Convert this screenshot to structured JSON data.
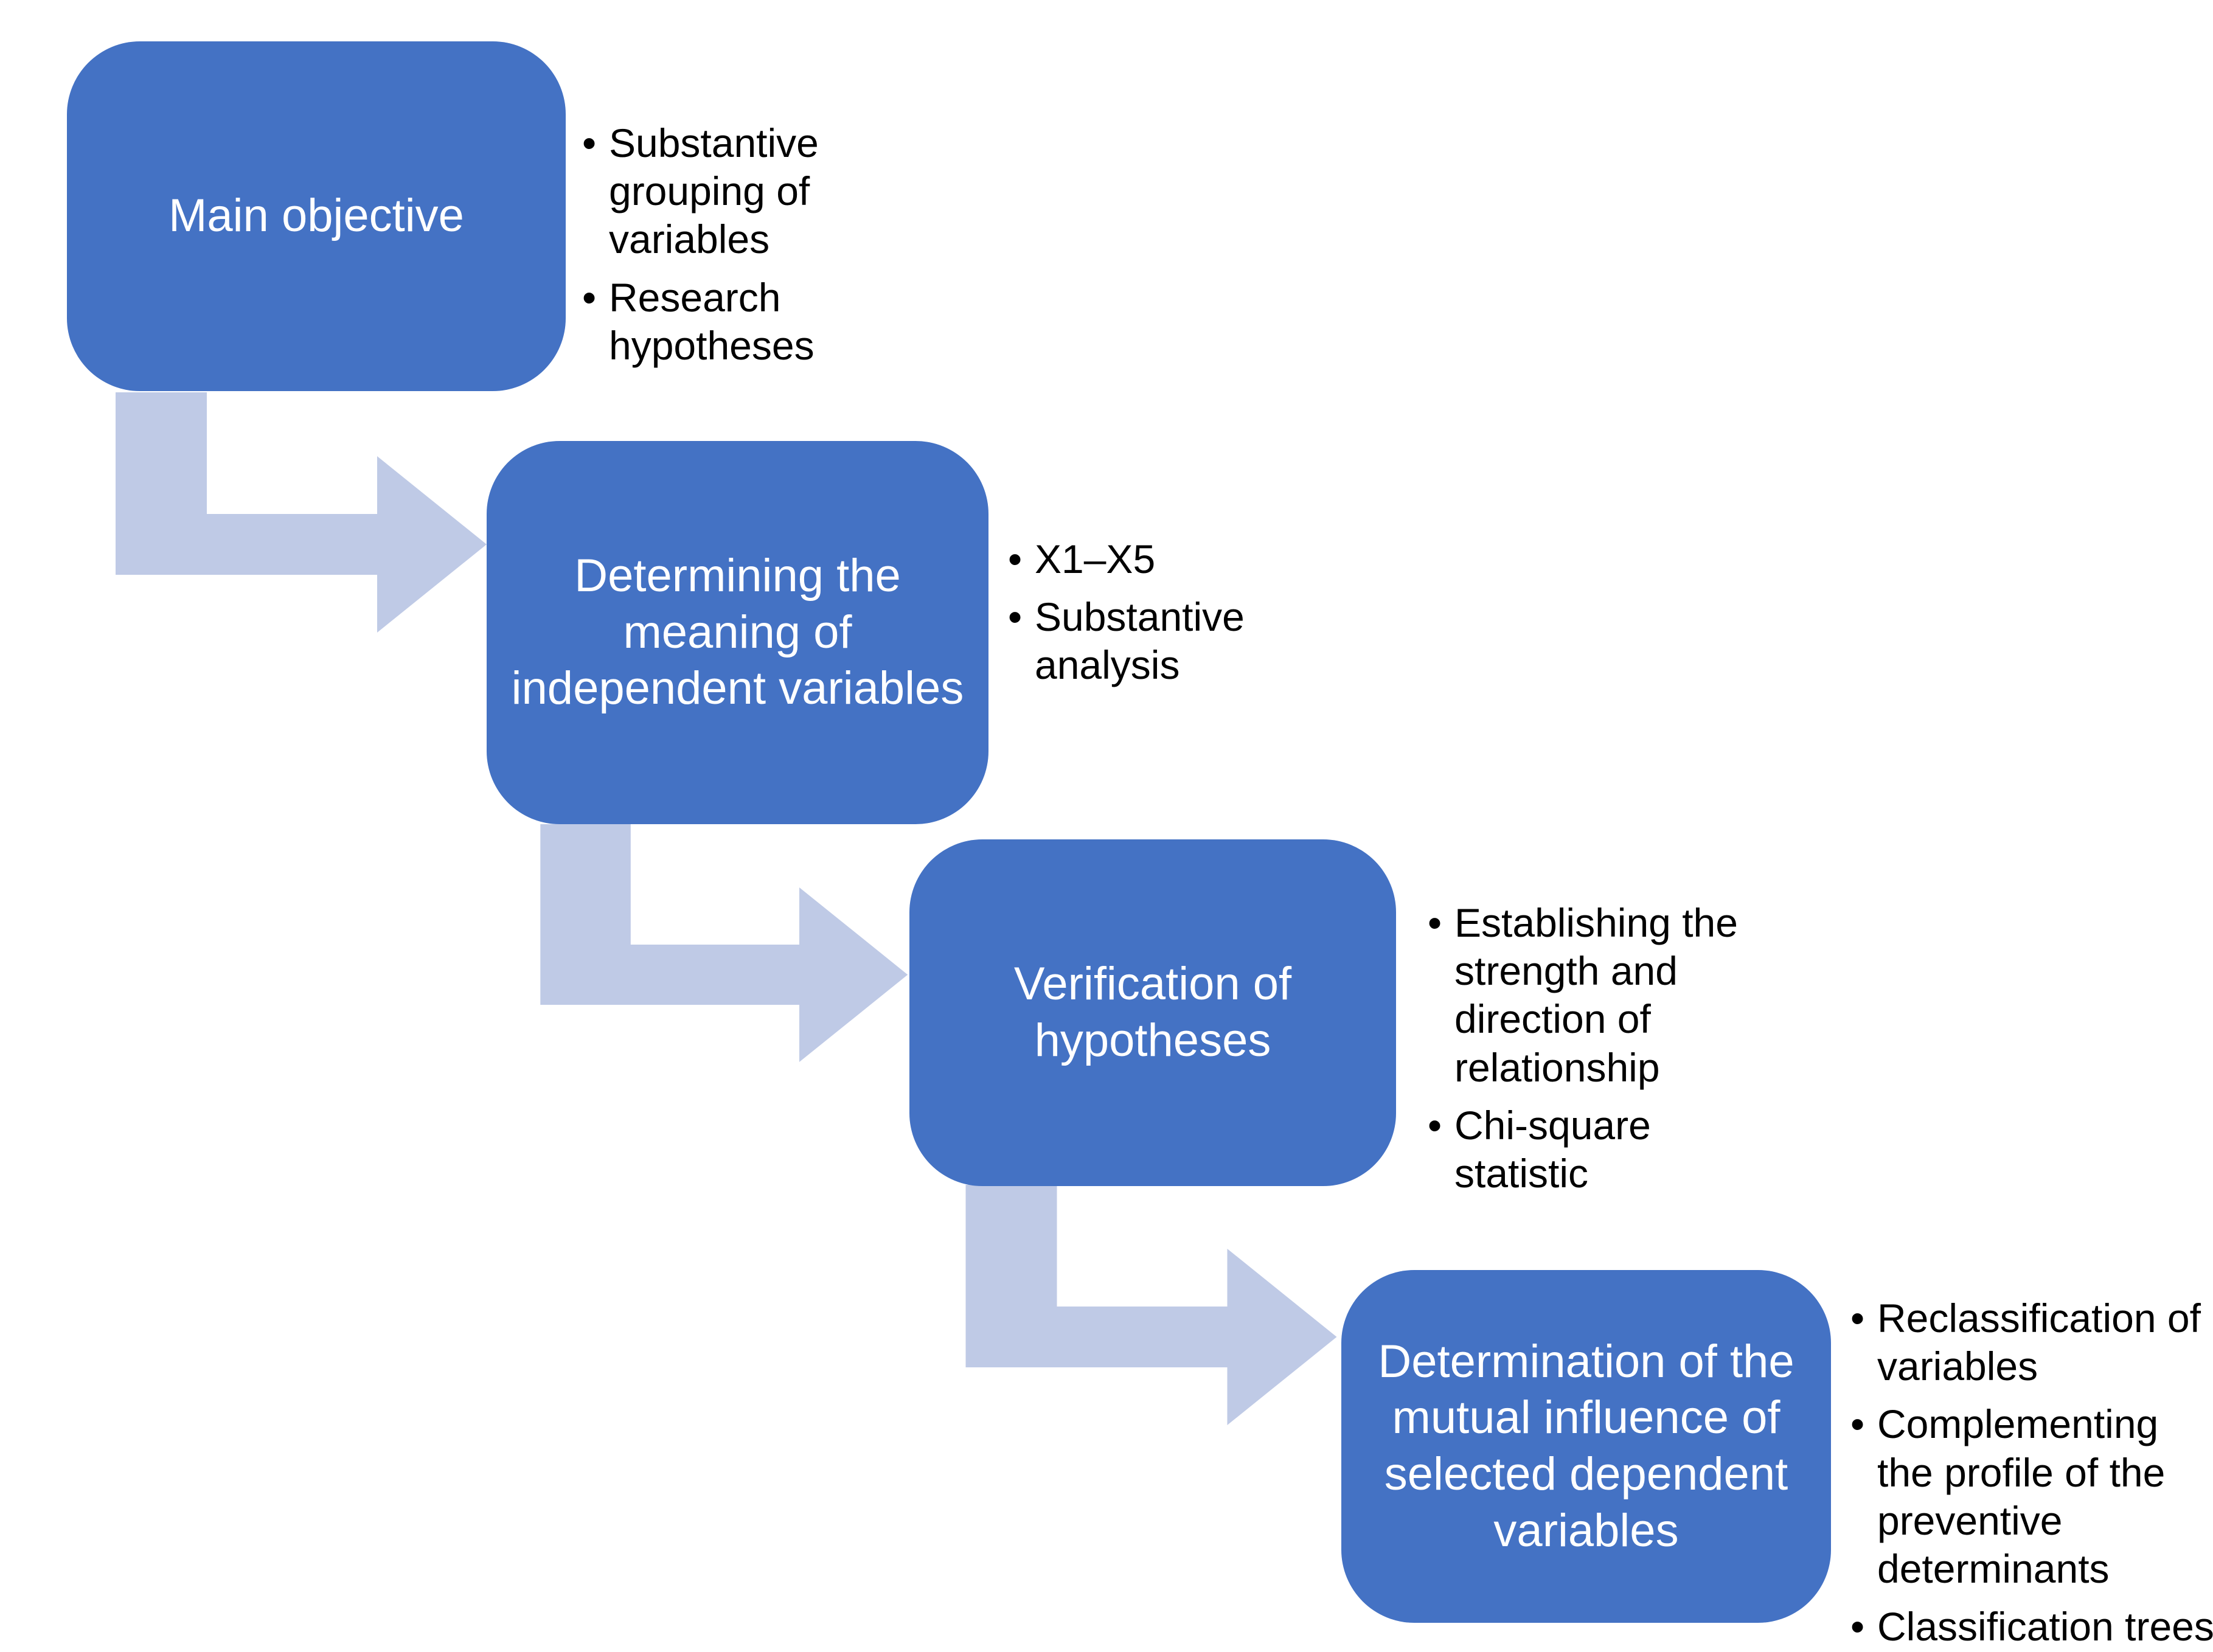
{
  "diagram": {
    "title": "Research process flow diagram",
    "colors": {
      "box_fill": "#4472C4",
      "box_text": "#FFFFFF",
      "arrow_fill": "#BFCAE6",
      "bullet_text": "#000000",
      "background": "#FFFFFF"
    },
    "stages": [
      {
        "id": "stage-1",
        "label": "Main objective",
        "bullets": [
          "Substantive grouping of variables",
          "Research hypotheses"
        ]
      },
      {
        "id": "stage-2",
        "label": "Determining the meaning of independent variables",
        "bullets": [
          "X1–X5",
          "Substantive analysis"
        ]
      },
      {
        "id": "stage-3",
        "label": "Verification of hypotheses",
        "bullets": [
          "Establishing the strength and direction of relationship",
          "Chi-square statistic"
        ]
      },
      {
        "id": "stage-4",
        "label": "Determination of the mutual influence of selected dependent variables",
        "bullets": [
          "Reclassification of variables",
          "Complementing the profile of the preventive determinants",
          "Classification trees"
        ]
      }
    ],
    "connectors": [
      {
        "id": "connector-1",
        "from": "stage-1",
        "to": "stage-2",
        "shape": "bent-arrow-down-right"
      },
      {
        "id": "connector-2",
        "from": "stage-2",
        "to": "stage-3",
        "shape": "bent-arrow-down-right"
      },
      {
        "id": "connector-3",
        "from": "stage-3",
        "to": "stage-4",
        "shape": "bent-arrow-down-right"
      }
    ]
  }
}
